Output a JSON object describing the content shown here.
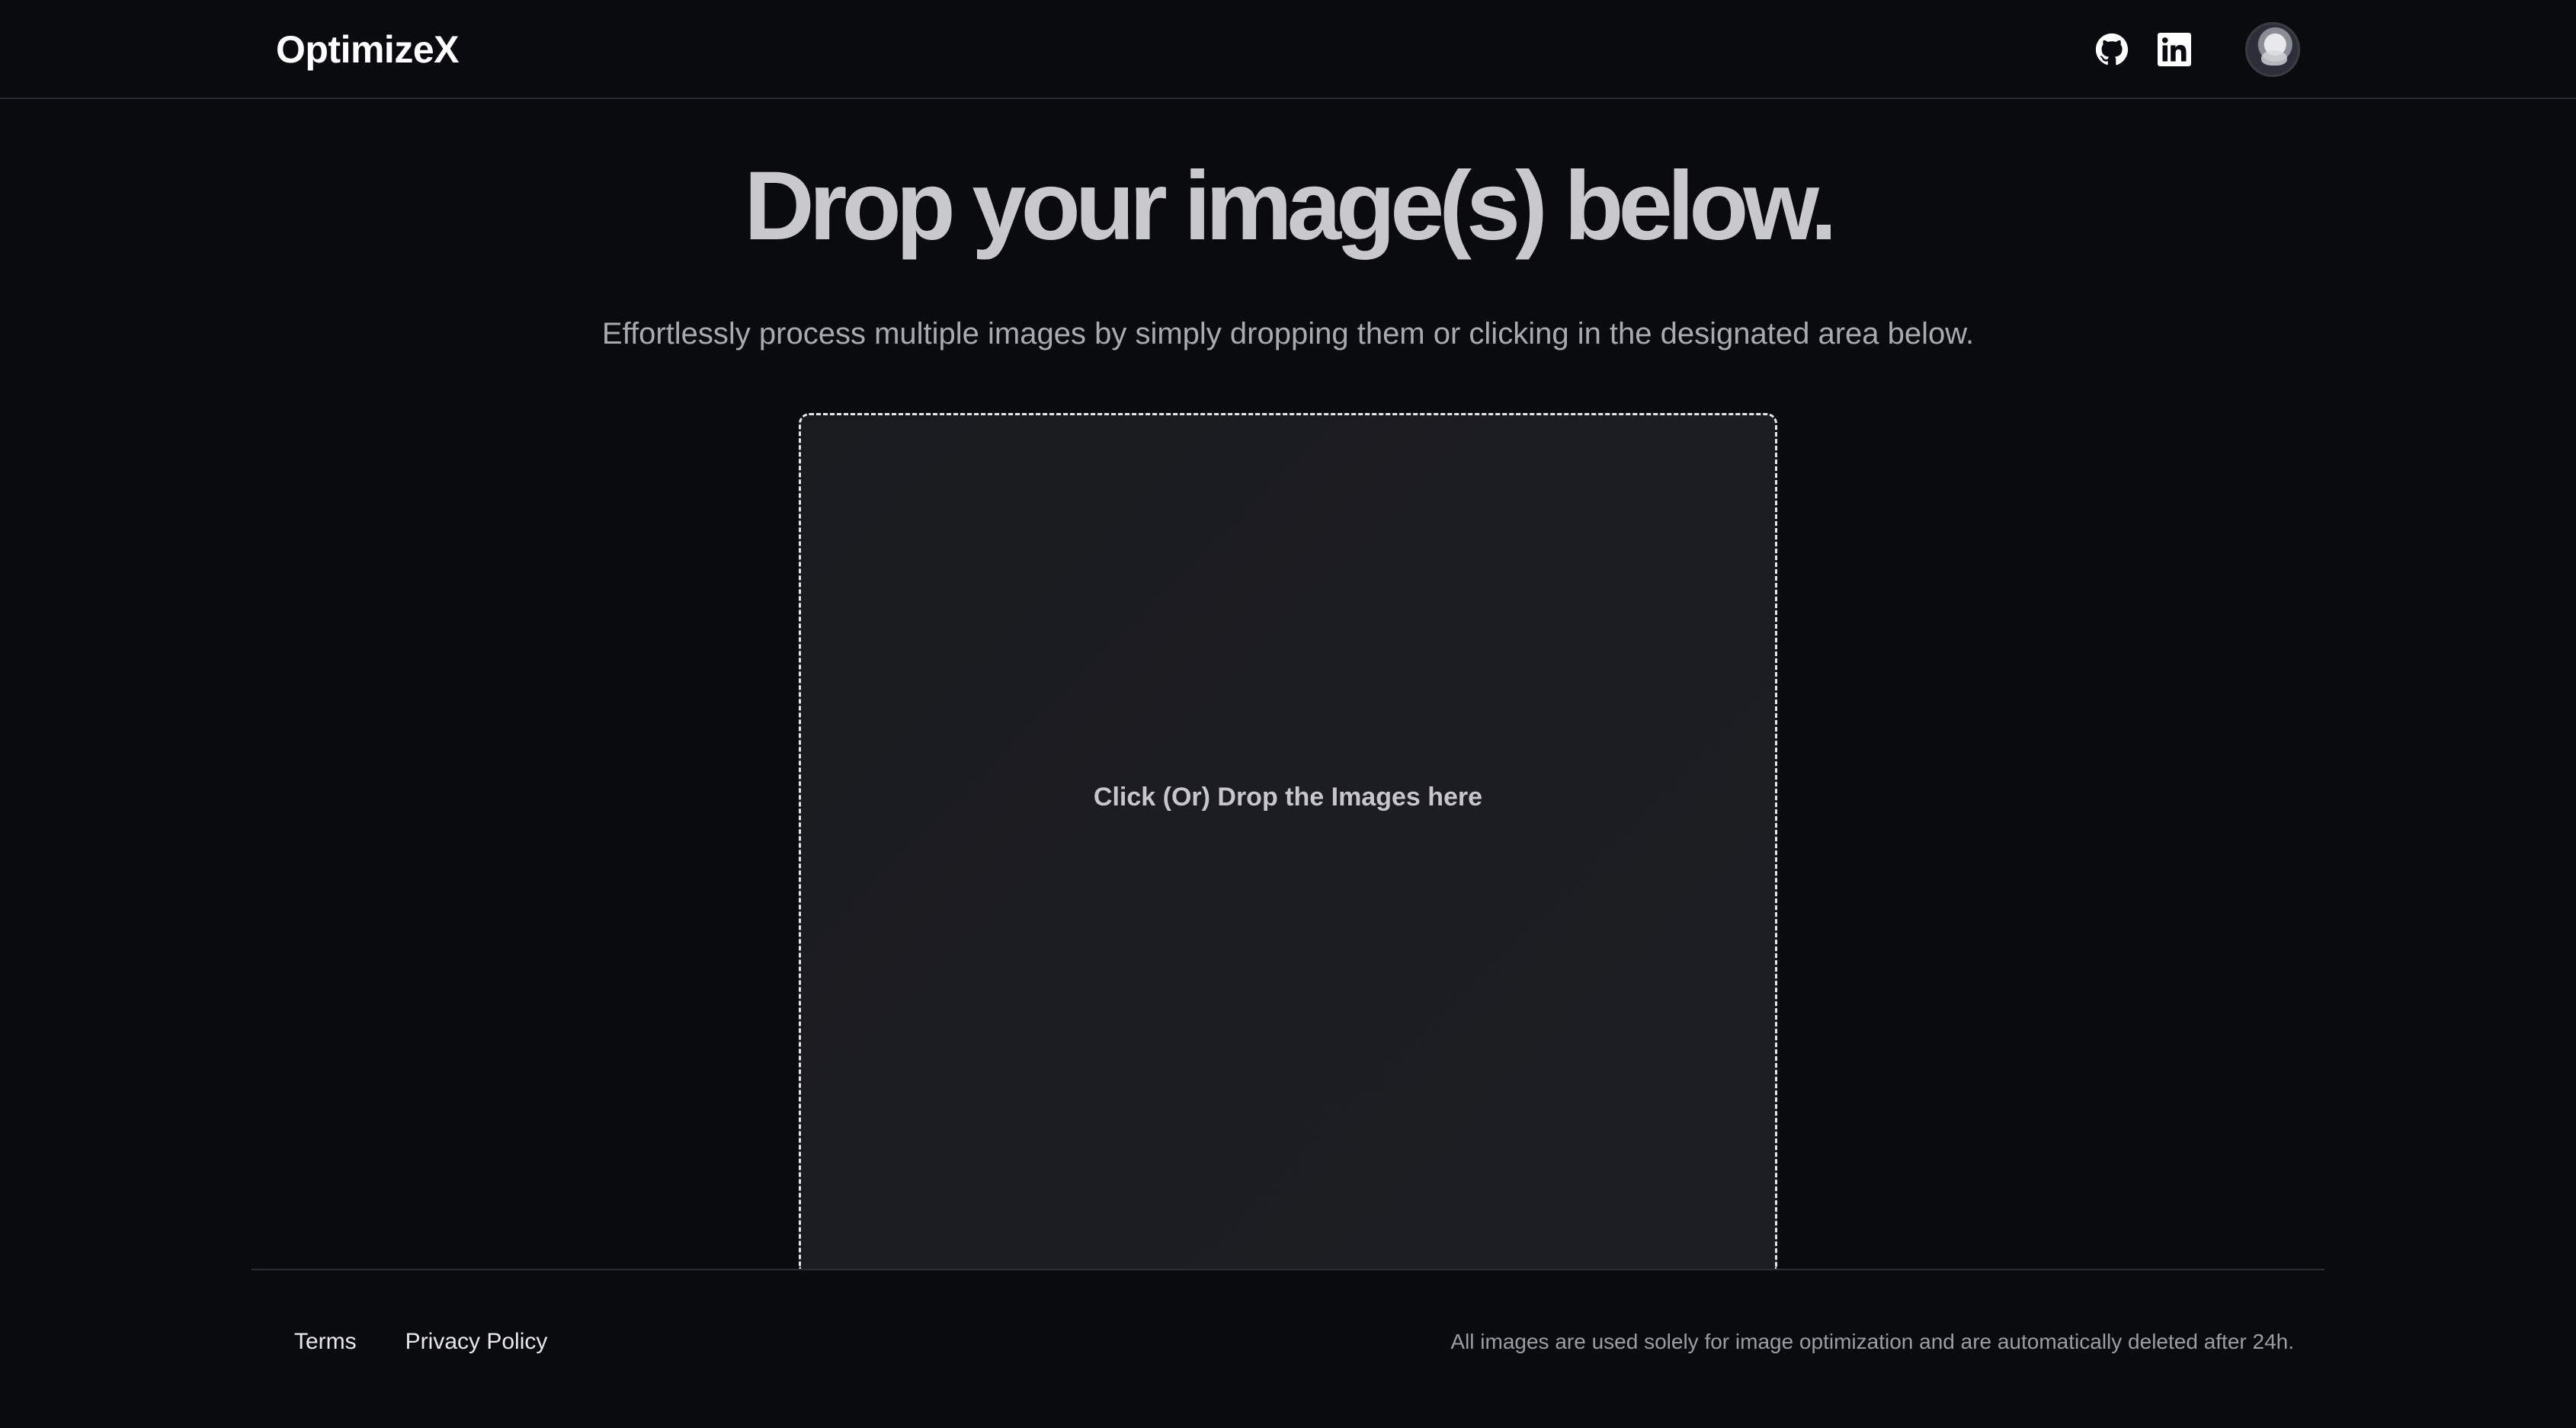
{
  "header": {
    "brand": "OptimizeX",
    "icons": [
      "github-icon",
      "linkedin-icon",
      "avatar"
    ]
  },
  "hero": {
    "title": "Drop your image(s) below.",
    "subtitle": "Effortlessly process multiple images by simply dropping them or clicking in the designated area below."
  },
  "dropzone": {
    "label": "Click (Or) Drop the Images here"
  },
  "footer": {
    "links": [
      "Terms",
      "Privacy Policy"
    ],
    "note": "All images are used solely for image optimization and are automatically deleted after 24h."
  },
  "colors": {
    "background": "#0a0b0e",
    "dropzone_bg": "#1b1c21",
    "title": "#c9c9cd",
    "border": "#2a2b30"
  }
}
